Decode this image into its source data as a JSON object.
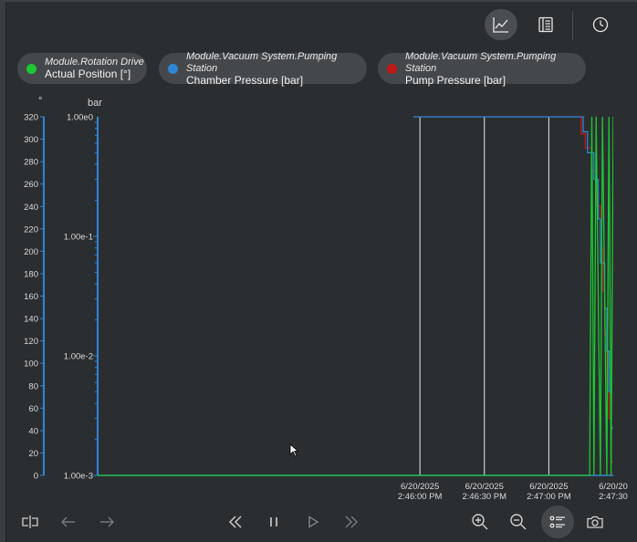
{
  "toolbar": {
    "chart_view_icon": "line-chart-icon",
    "table_view_icon": "list-view-icon",
    "history_icon": "clock-icon"
  },
  "legend": [
    {
      "module": "Module.Rotation Drive",
      "signal": "Actual Position [°]",
      "color": "#1cc832"
    },
    {
      "module": "Module.Vacuum System.Pumping Station",
      "signal": "Chamber Pressure [bar]",
      "color": "#2f86d6"
    },
    {
      "module": "Module.Vacuum System.Pumping Station",
      "signal": "Pump Pressure [bar]",
      "color": "#c01818"
    }
  ],
  "chart_data": {
    "type": "line",
    "left_axis": {
      "unit": "°",
      "ticks": [
        "320",
        "300",
        "280",
        "260",
        "240",
        "220",
        "200",
        "180",
        "160",
        "140",
        "120",
        "100",
        "80",
        "60",
        "40",
        "20",
        "0"
      ],
      "ylim": [
        0,
        320
      ]
    },
    "right_axis": {
      "unit": "bar",
      "scale": "log",
      "ticks": [
        "1.00e0",
        "1.00e-1",
        "1.00e-2",
        "1.00e-3"
      ],
      "ylim": [
        0.001,
        1
      ]
    },
    "x_ticks": [
      {
        "date": "6/20/2025",
        "time": "2:46:00 PM"
      },
      {
        "date": "6/20/2025",
        "time": "2:46:30 PM"
      },
      {
        "date": "6/20/2025",
        "time": "2:47:00 PM"
      },
      {
        "date": "6/20/20",
        "time": "2:47:30"
      }
    ],
    "grid": "vertical",
    "series": [
      {
        "name": "Pump Pressure [bar]",
        "color": "#c01818",
        "points": [
          [
            -3,
            1.0
          ],
          [
            75,
            1.0
          ],
          [
            75,
            0.72
          ],
          [
            77,
            0.72
          ],
          [
            77,
            0.55
          ],
          [
            80,
            0.55
          ],
          [
            80,
            0.35
          ],
          [
            82,
            0.35
          ],
          [
            82,
            0.18
          ],
          [
            84,
            0.18
          ],
          [
            84,
            0.08
          ],
          [
            85,
            0.08
          ],
          [
            85,
            0.035
          ],
          [
            86,
            0.035
          ],
          [
            86,
            0.015
          ],
          [
            87,
            0.015
          ],
          [
            87,
            0.006
          ],
          [
            88,
            0.006
          ],
          [
            88,
            0.003
          ],
          [
            89,
            0.003
          ],
          [
            89,
            0.0013
          ],
          [
            90,
            0.0013
          ]
        ]
      },
      {
        "name": "Chamber Pressure [bar]",
        "color": "#2f86d6",
        "points": [
          [
            -3,
            1.0
          ],
          [
            76,
            1.0
          ],
          [
            76,
            0.75
          ],
          [
            78,
            0.75
          ],
          [
            78,
            0.5
          ],
          [
            81,
            0.5
          ],
          [
            81,
            0.3
          ],
          [
            83,
            0.3
          ],
          [
            83,
            0.14
          ],
          [
            84,
            0.14
          ],
          [
            84,
            0.06
          ],
          [
            86,
            0.06
          ],
          [
            86,
            0.025
          ],
          [
            87,
            0.025
          ],
          [
            87,
            0.011
          ],
          [
            88,
            0.011
          ],
          [
            88,
            0.005
          ],
          [
            89,
            0.005
          ],
          [
            89,
            0.0025
          ],
          [
            90,
            0.0025
          ]
        ]
      },
      {
        "name": "Actual Position [°]",
        "color": "#1cc832",
        "points": [
          [
            -150,
            0
          ],
          [
            79,
            0
          ],
          [
            80,
            320
          ],
          [
            81,
            0
          ],
          [
            82,
            320
          ],
          [
            84,
            0
          ],
          [
            85,
            320
          ],
          [
            87,
            0
          ],
          [
            88,
            320
          ],
          [
            89,
            0
          ],
          [
            90,
            320
          ],
          [
            91,
            250
          ]
        ]
      }
    ]
  },
  "bottom": {
    "split_icon": "split-view-icon",
    "back_icon": "arrow-left-icon",
    "forward_icon": "arrow-right-icon",
    "rewind_icon": "fast-rewind-icon",
    "pause_icon": "pause-icon",
    "play_icon": "play-icon",
    "fast_forward_icon": "fast-forward-icon",
    "zoom_in_icon": "zoom-in-icon",
    "zoom_out_icon": "zoom-out-icon",
    "legend_toggle_icon": "legend-list-icon",
    "snapshot_icon": "camera-icon"
  }
}
